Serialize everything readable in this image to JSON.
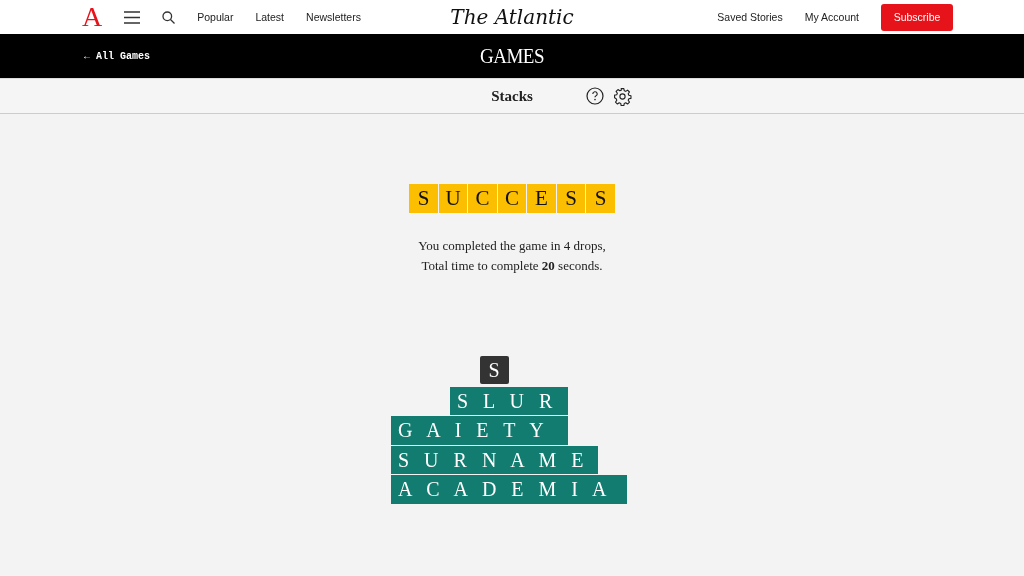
{
  "nav": {
    "logo": "A",
    "links": [
      "Popular",
      "Latest",
      "Newsletters"
    ],
    "brand": "The Atlantic",
    "right_links": [
      "Saved Stories",
      "My Account"
    ],
    "subscribe": "Subscribe"
  },
  "games_bar": {
    "back": "← All Games",
    "title": "GAMES"
  },
  "game_header": {
    "title": "Stacks"
  },
  "result": {
    "tiles": [
      "S",
      "U",
      "C",
      "C",
      "E",
      "S",
      "S"
    ],
    "line_1": "You completed the game in 4 drops,",
    "line_2": "Total time to complete **20** seconds."
  },
  "falling_tile": {
    "letter": "S"
  },
  "stack": [
    {
      "word": "S L U R"
    },
    {
      "word": "G A I E T Y"
    },
    {
      "word": "S U R N A M E"
    },
    {
      "word": "A C A D E M I A"
    }
  ]
}
